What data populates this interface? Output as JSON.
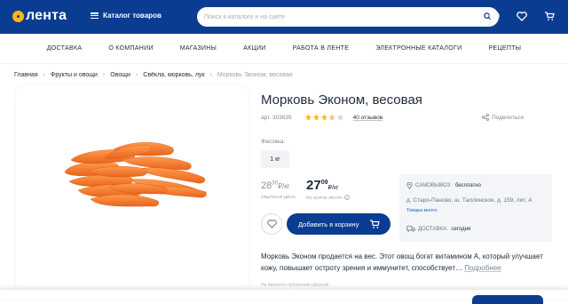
{
  "header": {
    "logo_text": "лента",
    "catalog_label": "Каталог товаров",
    "search_placeholder": "Поиск в каталоге и на сайте",
    "icons": [
      "search-icon",
      "user-icon",
      "heart-icon",
      "cart-icon"
    ]
  },
  "nav": {
    "items": [
      "ДОСТАВКА",
      "О КОМПАНИИ",
      "МАГАЗИНЫ",
      "АКЦИИ",
      "РАБОТА В ЛЕНТЕ",
      "ЭЛЕКТРОННЫЕ КАТАЛОГИ",
      "РЕЦЕПТЫ"
    ]
  },
  "breadcrumbs": [
    "Главная",
    "Фрукты и овощи",
    "Овощи",
    "Свёкла, морковь, лук",
    "Морковь Эконом, весовая"
  ],
  "product": {
    "title": "Морковь Эконом, весовая",
    "sku": "арт. 303639",
    "rating": 3.5,
    "reviews": "40 отзывов",
    "share": "Поделиться",
    "pack_label": "Фасовка:",
    "pack_value": "1 кг",
    "old_price_int": "28",
    "old_price_frac": "39",
    "old_price_unit": "₽/кг",
    "old_price_caption": "ОБЫЧНАЯ ЦЕНА",
    "new_price_int": "27",
    "new_price_frac": "09",
    "new_price_unit": "₽/кг",
    "new_price_caption": "ПО КАРТЕ ЛЕНТА",
    "cart_button": "Добавить в корзину",
    "description": "Морковь Эконом продается на вес. Этот овощ богат витамином А, который улучшает кожу, повышает остроту зрения и иммунитет, способствует…",
    "more": "Подробнее",
    "faded_note": "Не является публичной офертой"
  },
  "delivery": {
    "pickup_label": "САМОВЫВОЗ:",
    "pickup_value": "бесплатно",
    "address": "д. Старо-Паново, ш. Таллинское, д. 159, лит. А",
    "another_store": "Товара много",
    "delivery_label": "ДОСТАВКА:",
    "delivery_value": "сегодня"
  },
  "colors": {
    "brand_blue": "#0a3d91",
    "brand_yellow": "#ffb81c",
    "star": "#ffb81c",
    "carrot": "#f47a2a"
  }
}
